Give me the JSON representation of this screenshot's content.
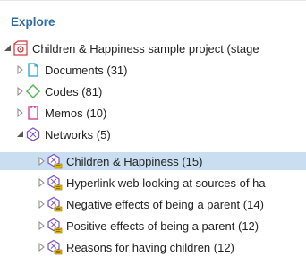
{
  "panel": {
    "title": "Explore"
  },
  "tree": {
    "project": {
      "label": "Children & Happiness sample project (stage"
    },
    "documents": {
      "label": "Documents (31)"
    },
    "codes": {
      "label": "Codes (81)"
    },
    "memos": {
      "label": "Memos (10)"
    },
    "networks": {
      "label": "Networks (5)"
    },
    "network_items": [
      {
        "label": "Children & Happiness (15)",
        "selected": true
      },
      {
        "label": "Hyperlink web looking at sources of ha",
        "selected": false
      },
      {
        "label": "Negative effects of being a parent (14)",
        "selected": false
      },
      {
        "label": "Positive effects of being a parent (12)",
        "selected": false
      },
      {
        "label": "Reasons for having children (12)",
        "selected": false
      }
    ]
  },
  "colors": {
    "title": "#2e6da4",
    "selection": "#c9def1",
    "documents_icon": "#2a9fd6",
    "codes_icon": "#4cb848",
    "memos_icon": "#d6338a",
    "networks_icon": "#7a54c0",
    "badge": "#f2c200"
  }
}
